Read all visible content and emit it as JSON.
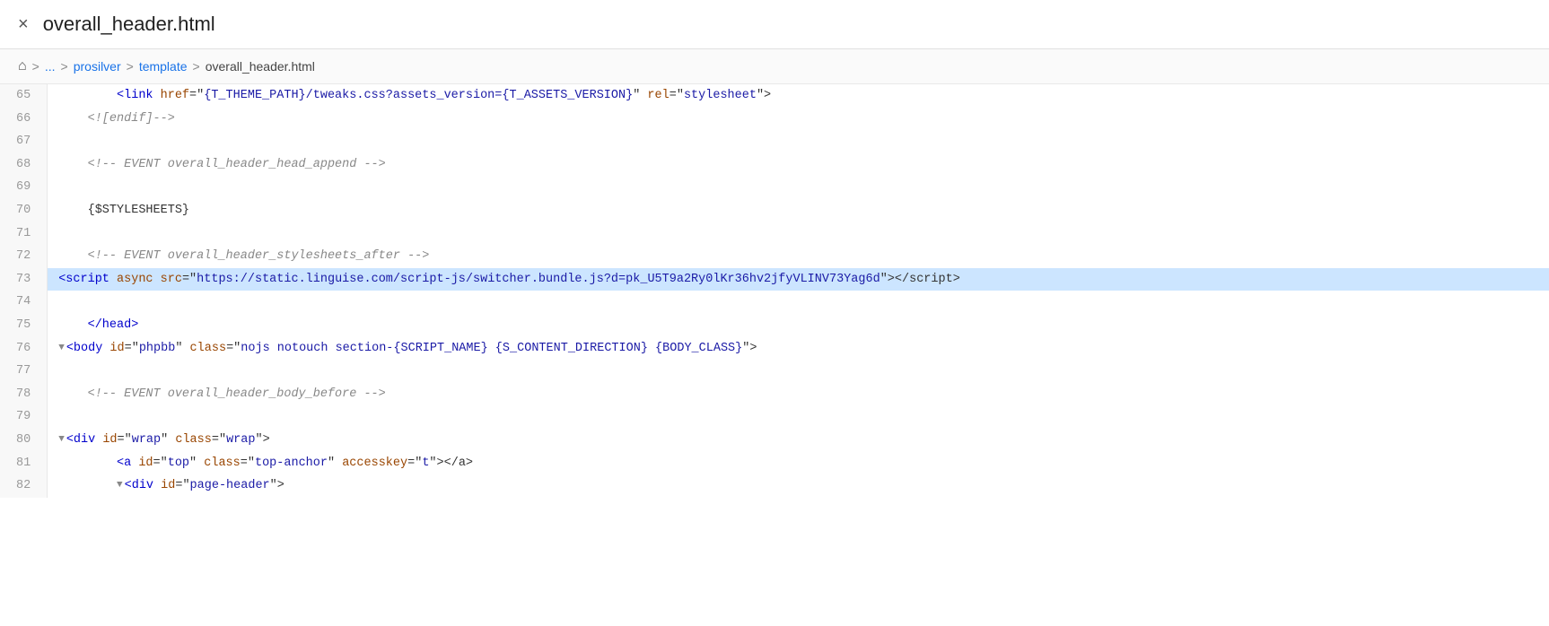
{
  "titleBar": {
    "closeLabel": "×",
    "title": "overall_header.html"
  },
  "breadcrumb": {
    "homeIcon": "🏠",
    "items": [
      "...",
      "prosilver",
      "template",
      "overall_header.html"
    ]
  },
  "lines": [
    {
      "num": 65,
      "indent": "        ",
      "content": "<link href=\"{T_THEME_PATH}/tweaks.css?assets_version={T_ASSETS_VERSION}\" rel=\"stylesheet\">",
      "highlight": false,
      "collapse": false
    },
    {
      "num": 66,
      "indent": "    ",
      "content": "<![endif]-->",
      "highlight": false,
      "collapse": false
    },
    {
      "num": 67,
      "indent": "",
      "content": "",
      "highlight": false,
      "collapse": false
    },
    {
      "num": 68,
      "indent": "    ",
      "content": "<!-- EVENT overall_header_head_append -->",
      "highlight": false,
      "collapse": false
    },
    {
      "num": 69,
      "indent": "",
      "content": "",
      "highlight": false,
      "collapse": false
    },
    {
      "num": 70,
      "indent": "    ",
      "content": "{$STYLESHEETS}",
      "highlight": false,
      "collapse": false
    },
    {
      "num": 71,
      "indent": "",
      "content": "",
      "highlight": false,
      "collapse": false
    },
    {
      "num": 72,
      "indent": "    ",
      "content": "<!-- EVENT overall_header_stylesheets_after -->",
      "highlight": false,
      "collapse": false
    },
    {
      "num": 73,
      "indent": "    ",
      "content": "<script async src=\"https://static.linguise.com/script-js/switcher.bundle.js?d=pk_U5T9a2Ry0lKr36hv2jfyVLINV73Yag6d\"></script>",
      "highlight": true,
      "collapse": false
    },
    {
      "num": 74,
      "indent": "",
      "content": "",
      "highlight": false,
      "collapse": false
    },
    {
      "num": 75,
      "indent": "    ",
      "content": "</head>",
      "highlight": false,
      "collapse": false
    },
    {
      "num": 76,
      "indent": "",
      "content": "<body id=\"phpbb\" class=\"nojs notouch section-{SCRIPT_NAME} {S_CONTENT_DIRECTION} {BODY_CLASS}\">",
      "highlight": false,
      "collapse": true
    },
    {
      "num": 77,
      "indent": "",
      "content": "",
      "highlight": false,
      "collapse": false
    },
    {
      "num": 78,
      "indent": "    ",
      "content": "<!-- EVENT overall_header_body_before -->",
      "highlight": false,
      "collapse": false
    },
    {
      "num": 79,
      "indent": "",
      "content": "",
      "highlight": false,
      "collapse": false
    },
    {
      "num": 80,
      "indent": "",
      "content": "<div id=\"wrap\" class=\"wrap\">",
      "highlight": false,
      "collapse": true
    },
    {
      "num": 81,
      "indent": "        ",
      "content": "<a id=\"top\" class=\"top-anchor\" accesskey=\"t\"></a>",
      "highlight": false,
      "collapse": false
    },
    {
      "num": 82,
      "indent": "        ",
      "content": "<div id=\"page-header\">",
      "highlight": false,
      "collapse": true
    }
  ]
}
